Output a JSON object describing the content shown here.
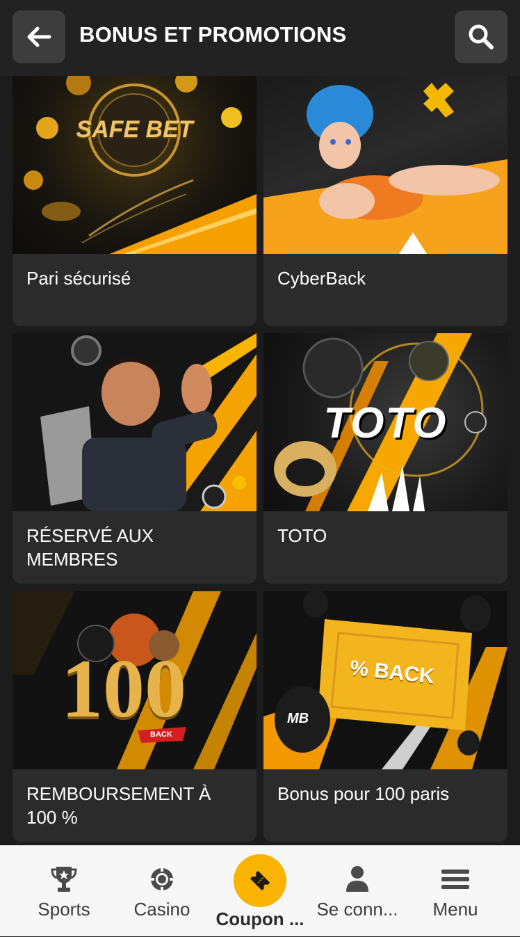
{
  "header": {
    "title": "BONUS ET PROMOTIONS",
    "back_icon": "arrow-left-icon",
    "search_icon": "search-icon"
  },
  "promotions": [
    {
      "label": "Pari sécurisé",
      "banner_text": "SAFE BET"
    },
    {
      "label": "CyberBack",
      "banner_text": ""
    },
    {
      "label": "RÉSERVÉ AUX MEMBRES",
      "banner_text": ""
    },
    {
      "label": "TOTO",
      "banner_text": "TOTO"
    },
    {
      "label": "REMBOURSEMENT À 100 %",
      "banner_text": "100",
      "banner_sub": "BACK"
    },
    {
      "label": "Bonus pour 100 paris",
      "banner_text": "% BACK",
      "badge": "MB"
    }
  ],
  "bottom_nav": [
    {
      "label": "Sports",
      "icon": "trophy-icon"
    },
    {
      "label": "Casino",
      "icon": "casino-chip-icon"
    },
    {
      "label": "Coupon ...",
      "icon": "ticket-icon",
      "active": true
    },
    {
      "label": "Se conn...",
      "icon": "user-icon"
    },
    {
      "label": "Menu",
      "icon": "hamburger-menu-icon"
    }
  ],
  "colors": {
    "background": "#1c1c1c",
    "header": "#222222",
    "card": "#2b2b2b",
    "accent": "#f9b300",
    "nav_background": "#f7f7f7"
  }
}
